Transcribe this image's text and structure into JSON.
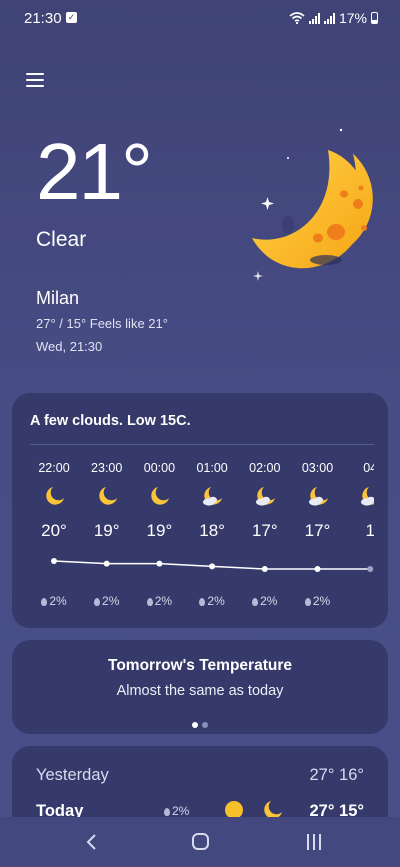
{
  "status": {
    "time": "21:30",
    "battery": "17%"
  },
  "current": {
    "temperature": "21°",
    "condition": "Clear",
    "city": "Milan",
    "range_feels": "27° / 15° Feels like 21°",
    "datetime": "Wed, 21:30"
  },
  "hourly": {
    "summary": "A few clouds. Low 15C.",
    "hours": [
      {
        "time": "22:00",
        "temp": "20°",
        "precip": "2%",
        "icon": "moon-icon"
      },
      {
        "time": "23:00",
        "temp": "19°",
        "precip": "2%",
        "icon": "moon-icon"
      },
      {
        "time": "00:00",
        "temp": "19°",
        "precip": "2%",
        "icon": "moon-icon"
      },
      {
        "time": "01:00",
        "temp": "18°",
        "precip": "2%",
        "icon": "moon-cloud-icon"
      },
      {
        "time": "02:00",
        "temp": "17°",
        "precip": "2%",
        "icon": "moon-cloud-icon"
      },
      {
        "time": "03:00",
        "temp": "17°",
        "precip": "2%",
        "icon": "moon-cloud-icon"
      },
      {
        "time": "04",
        "temp": "1",
        "precip": "",
        "icon": "moon-cloud-icon"
      }
    ],
    "graph_values": [
      20,
      19,
      19,
      18,
      17,
      17,
      17
    ]
  },
  "tomorrow": {
    "title": "Tomorrow's Temperature",
    "subtitle": "Almost the same as today"
  },
  "daily": {
    "yesterday": {
      "label": "Yesterday",
      "temps": "27° 16°"
    },
    "today": {
      "label": "Today",
      "precip": "2%",
      "temps": "27° 15°"
    }
  },
  "colors": {
    "sun": "#f7c02b",
    "moon": "#f9c33a",
    "crater": "#f07a1a"
  }
}
